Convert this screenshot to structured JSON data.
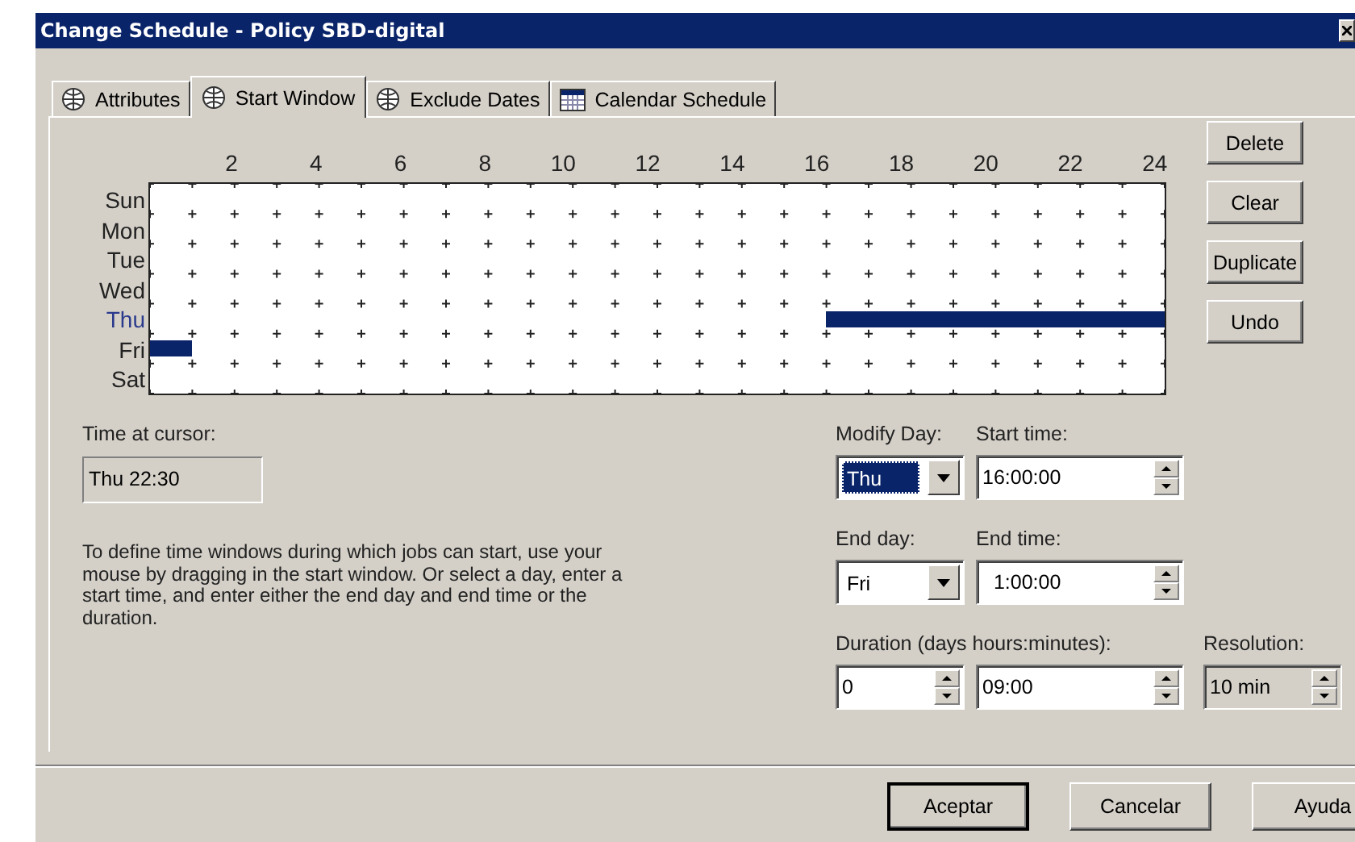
{
  "window": {
    "title": "Change Schedule - Policy SBD-digital"
  },
  "tabs": [
    {
      "label": "Attributes",
      "selected": false
    },
    {
      "label": "Start Window",
      "selected": true
    },
    {
      "label": "Exclude Dates",
      "selected": false
    },
    {
      "label": "Calendar Schedule",
      "selected": false
    }
  ],
  "schedule": {
    "hours": [
      "2",
      "4",
      "6",
      "8",
      "10",
      "12",
      "14",
      "16",
      "18",
      "20",
      "22",
      "24"
    ],
    "days": [
      {
        "label": "Sun",
        "selected": false
      },
      {
        "label": "Mon",
        "selected": false
      },
      {
        "label": "Tue",
        "selected": false
      },
      {
        "label": "Wed",
        "selected": false
      },
      {
        "label": "Thu",
        "selected": true,
        "window": {
          "kind": "to_end",
          "level": 0.3333
        }
      },
      {
        "label": "Fri",
        "selected": false,
        "window": {
          "kind": "from_start",
          "level": 0.0417
        }
      },
      {
        "label": "Sat",
        "selected": false
      }
    ]
  },
  "side_buttons": [
    "Delete",
    "Clear",
    "Duplicate",
    "Undo"
  ],
  "cursor": {
    "label": "Time at cursor:",
    "value": "Thu 22:30"
  },
  "help_text": "To define time windows during which jobs can start, use your mouse by dragging in the start window.  Or select a day, enter a start time, and enter either the end day and end time or the duration.",
  "form": {
    "modify_day": {
      "label": "Modify Day:",
      "value": "Thu",
      "focused": true
    },
    "start_time": {
      "label": "Start time:",
      "value": "16:00:00"
    },
    "end_day": {
      "label": "End day:",
      "value": "Fri",
      "focused": false
    },
    "end_time": {
      "label": "End time:",
      "value": "  1:00:00"
    },
    "duration": {
      "label": "Duration (days hours:minutes):",
      "days": "0",
      "time": "09:00"
    },
    "resolution": {
      "label": "Resolution:",
      "value": "10 min"
    }
  },
  "buttons": [
    {
      "label": "Aceptar",
      "default": true
    },
    {
      "label": "Cancelar",
      "default": false
    },
    {
      "label": "Ayuda",
      "default": false
    }
  ]
}
